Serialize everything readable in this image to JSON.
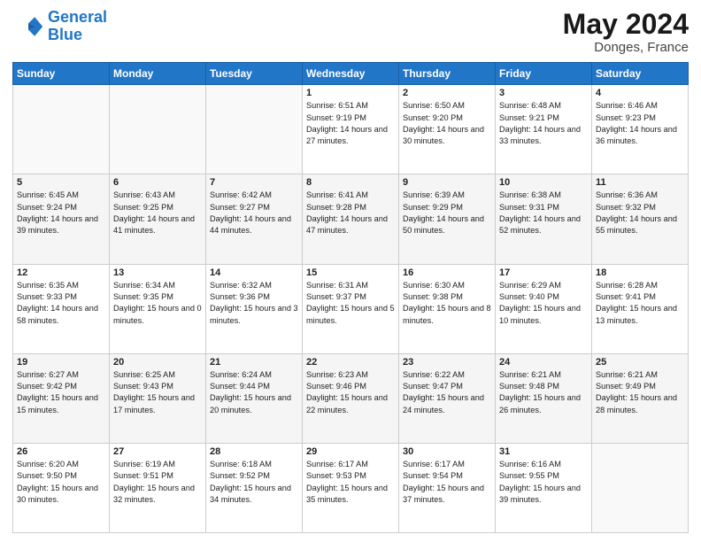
{
  "header": {
    "logo_line1": "General",
    "logo_line2": "Blue",
    "title": "May 2024",
    "subtitle": "Donges, France"
  },
  "columns": [
    "Sunday",
    "Monday",
    "Tuesday",
    "Wednesday",
    "Thursday",
    "Friday",
    "Saturday"
  ],
  "weeks": [
    [
      {
        "day": "",
        "info": ""
      },
      {
        "day": "",
        "info": ""
      },
      {
        "day": "",
        "info": ""
      },
      {
        "day": "1",
        "info": "Sunrise: 6:51 AM\nSunset: 9:19 PM\nDaylight: 14 hours and 27 minutes."
      },
      {
        "day": "2",
        "info": "Sunrise: 6:50 AM\nSunset: 9:20 PM\nDaylight: 14 hours and 30 minutes."
      },
      {
        "day": "3",
        "info": "Sunrise: 6:48 AM\nSunset: 9:21 PM\nDaylight: 14 hours and 33 minutes."
      },
      {
        "day": "4",
        "info": "Sunrise: 6:46 AM\nSunset: 9:23 PM\nDaylight: 14 hours and 36 minutes."
      }
    ],
    [
      {
        "day": "5",
        "info": "Sunrise: 6:45 AM\nSunset: 9:24 PM\nDaylight: 14 hours and 39 minutes."
      },
      {
        "day": "6",
        "info": "Sunrise: 6:43 AM\nSunset: 9:25 PM\nDaylight: 14 hours and 41 minutes."
      },
      {
        "day": "7",
        "info": "Sunrise: 6:42 AM\nSunset: 9:27 PM\nDaylight: 14 hours and 44 minutes."
      },
      {
        "day": "8",
        "info": "Sunrise: 6:41 AM\nSunset: 9:28 PM\nDaylight: 14 hours and 47 minutes."
      },
      {
        "day": "9",
        "info": "Sunrise: 6:39 AM\nSunset: 9:29 PM\nDaylight: 14 hours and 50 minutes."
      },
      {
        "day": "10",
        "info": "Sunrise: 6:38 AM\nSunset: 9:31 PM\nDaylight: 14 hours and 52 minutes."
      },
      {
        "day": "11",
        "info": "Sunrise: 6:36 AM\nSunset: 9:32 PM\nDaylight: 14 hours and 55 minutes."
      }
    ],
    [
      {
        "day": "12",
        "info": "Sunrise: 6:35 AM\nSunset: 9:33 PM\nDaylight: 14 hours and 58 minutes."
      },
      {
        "day": "13",
        "info": "Sunrise: 6:34 AM\nSunset: 9:35 PM\nDaylight: 15 hours and 0 minutes."
      },
      {
        "day": "14",
        "info": "Sunrise: 6:32 AM\nSunset: 9:36 PM\nDaylight: 15 hours and 3 minutes."
      },
      {
        "day": "15",
        "info": "Sunrise: 6:31 AM\nSunset: 9:37 PM\nDaylight: 15 hours and 5 minutes."
      },
      {
        "day": "16",
        "info": "Sunrise: 6:30 AM\nSunset: 9:38 PM\nDaylight: 15 hours and 8 minutes."
      },
      {
        "day": "17",
        "info": "Sunrise: 6:29 AM\nSunset: 9:40 PM\nDaylight: 15 hours and 10 minutes."
      },
      {
        "day": "18",
        "info": "Sunrise: 6:28 AM\nSunset: 9:41 PM\nDaylight: 15 hours and 13 minutes."
      }
    ],
    [
      {
        "day": "19",
        "info": "Sunrise: 6:27 AM\nSunset: 9:42 PM\nDaylight: 15 hours and 15 minutes."
      },
      {
        "day": "20",
        "info": "Sunrise: 6:25 AM\nSunset: 9:43 PM\nDaylight: 15 hours and 17 minutes."
      },
      {
        "day": "21",
        "info": "Sunrise: 6:24 AM\nSunset: 9:44 PM\nDaylight: 15 hours and 20 minutes."
      },
      {
        "day": "22",
        "info": "Sunrise: 6:23 AM\nSunset: 9:46 PM\nDaylight: 15 hours and 22 minutes."
      },
      {
        "day": "23",
        "info": "Sunrise: 6:22 AM\nSunset: 9:47 PM\nDaylight: 15 hours and 24 minutes."
      },
      {
        "day": "24",
        "info": "Sunrise: 6:21 AM\nSunset: 9:48 PM\nDaylight: 15 hours and 26 minutes."
      },
      {
        "day": "25",
        "info": "Sunrise: 6:21 AM\nSunset: 9:49 PM\nDaylight: 15 hours and 28 minutes."
      }
    ],
    [
      {
        "day": "26",
        "info": "Sunrise: 6:20 AM\nSunset: 9:50 PM\nDaylight: 15 hours and 30 minutes."
      },
      {
        "day": "27",
        "info": "Sunrise: 6:19 AM\nSunset: 9:51 PM\nDaylight: 15 hours and 32 minutes."
      },
      {
        "day": "28",
        "info": "Sunrise: 6:18 AM\nSunset: 9:52 PM\nDaylight: 15 hours and 34 minutes."
      },
      {
        "day": "29",
        "info": "Sunrise: 6:17 AM\nSunset: 9:53 PM\nDaylight: 15 hours and 35 minutes."
      },
      {
        "day": "30",
        "info": "Sunrise: 6:17 AM\nSunset: 9:54 PM\nDaylight: 15 hours and 37 minutes."
      },
      {
        "day": "31",
        "info": "Sunrise: 6:16 AM\nSunset: 9:55 PM\nDaylight: 15 hours and 39 minutes."
      },
      {
        "day": "",
        "info": ""
      }
    ]
  ]
}
